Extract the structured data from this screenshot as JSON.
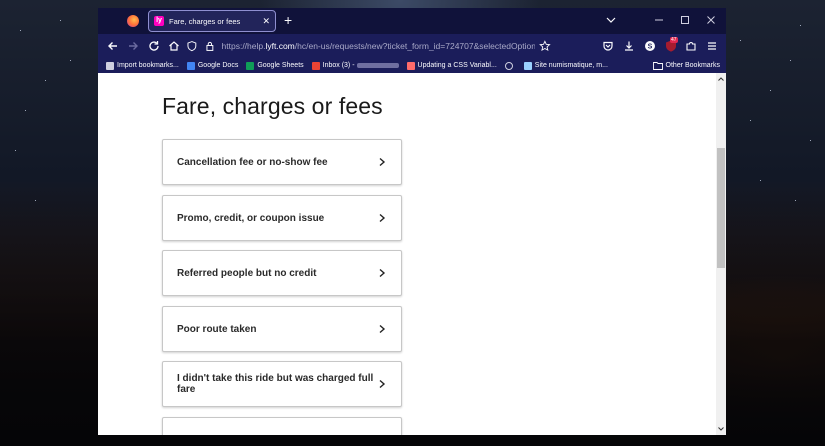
{
  "browser": {
    "tab": {
      "title": "Fare, charges or fees",
      "favicon": "lyft"
    },
    "url": {
      "scheme": "https://help.",
      "domain": "lyft.com",
      "path": "/hc/en-us/requests/new?ticket_form_id=724707&selectedOption"
    },
    "extensions_badge": "47",
    "bookmarks": [
      {
        "label": "Import bookmarks...",
        "icon": "import-icon",
        "color": "#cfcfe0"
      },
      {
        "label": "Google Docs",
        "icon": "google-docs-icon",
        "color": "#4285f4"
      },
      {
        "label": "Google Sheets",
        "icon": "google-sheets-icon",
        "color": "#0f9d58"
      },
      {
        "label": "Inbox (3) - ",
        "icon": "gmail-icon",
        "color": "#ea4335"
      },
      {
        "label": "Updating a CSS Variabl...",
        "icon": "codepen-icon",
        "color": "#ff6b6b"
      },
      {
        "label": "",
        "icon": "globe-icon",
        "color": "#cfcfe0"
      },
      {
        "label": "Site numismatique, m...",
        "icon": "site-icon",
        "color": "#9ad0ff"
      }
    ],
    "other_bookmarks": "Other Bookmarks"
  },
  "page": {
    "title": "Fare, charges or fees",
    "options": [
      "Cancellation fee or no-show fee",
      "Promo, credit, or coupon issue",
      "Referred people but no credit",
      "Poor route taken",
      "I didn't take this ride but was charged full fare",
      ""
    ]
  },
  "colors": {
    "titlebar": "#10123a",
    "toolbar": "#1b1d5a",
    "page_bg": "#ffffff"
  }
}
